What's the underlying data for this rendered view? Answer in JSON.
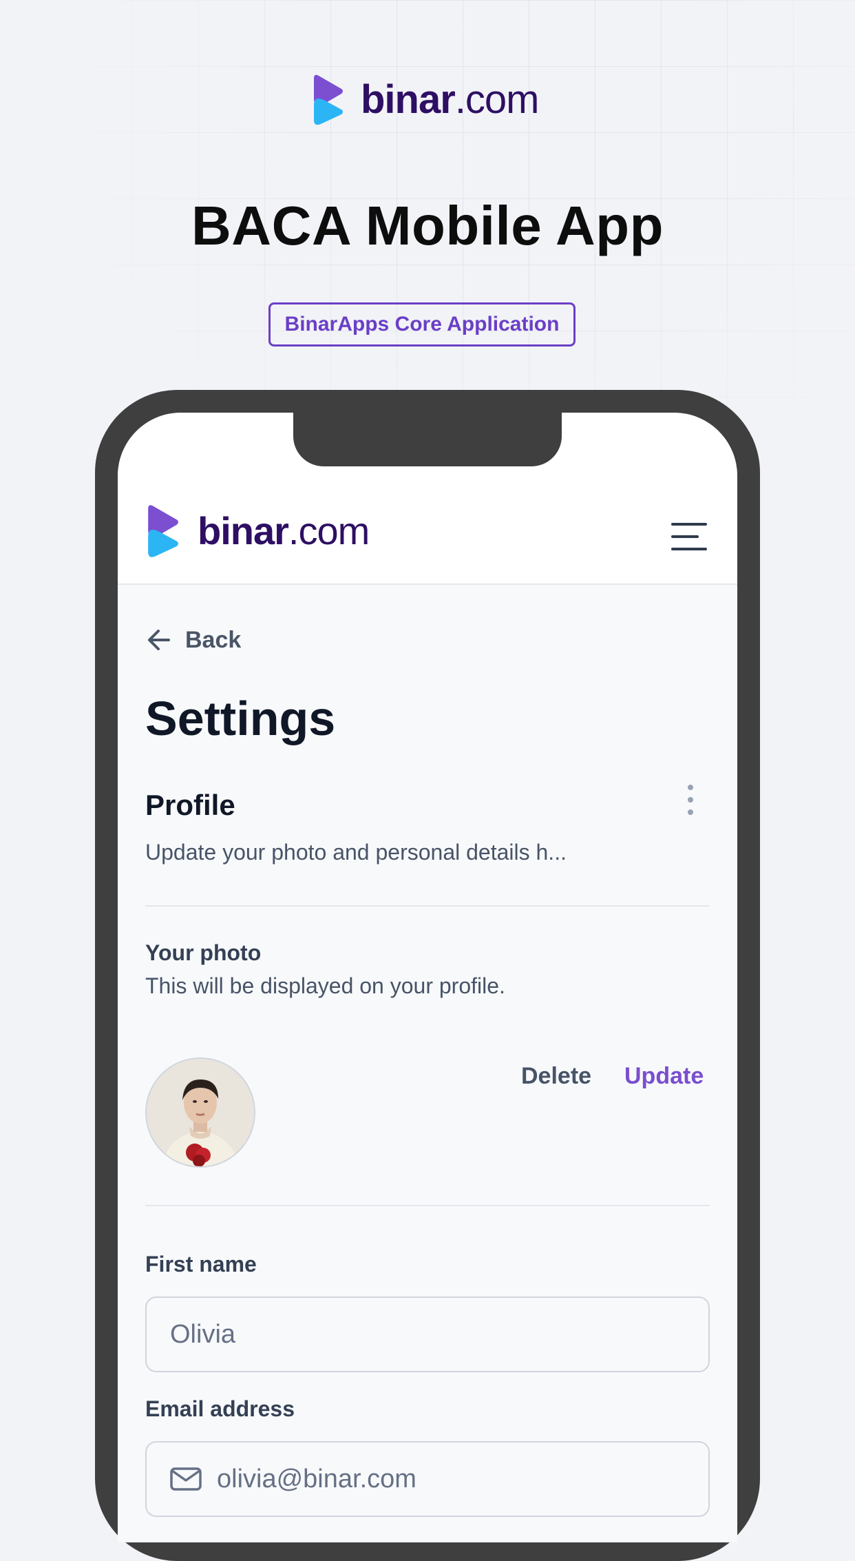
{
  "brand": {
    "name_strong": "binar",
    "name_light": ".com",
    "colors": {
      "purple": "#7b4fd0",
      "blue": "#2bb5f5",
      "dark_purple": "#2e0f63",
      "accent": "#6a3fc6"
    }
  },
  "hero": {
    "title": "BACA Mobile App",
    "badge": "BinarApps Core Application"
  },
  "app": {
    "header": {
      "menu_icon": "hamburger-menu-icon"
    },
    "back_label": "Back",
    "page_title": "Settings",
    "profile": {
      "title": "Profile",
      "description": "Update your photo and personal details h...",
      "more_icon": "vertical-dots-icon"
    },
    "photo": {
      "label": "Your photo",
      "hint": "This will be displayed on your profile.",
      "delete_label": "Delete",
      "update_label": "Update"
    },
    "form": {
      "first_name_label": "First name",
      "first_name_value": "Olivia",
      "email_label": "Email address",
      "email_value": "olivia@binar.com",
      "email_icon": "mail-icon"
    }
  }
}
